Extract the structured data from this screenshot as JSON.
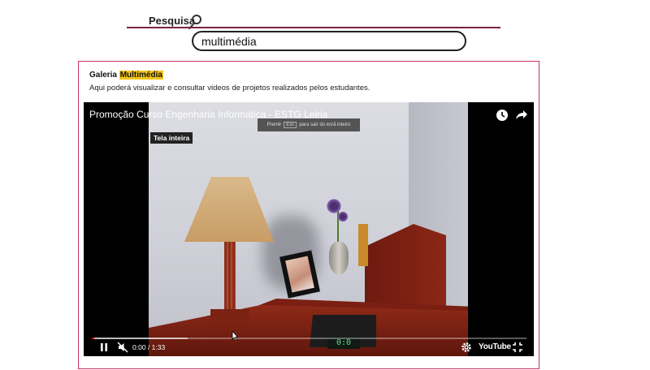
{
  "search": {
    "label": "Pesquisa",
    "value": "multimédia"
  },
  "gallery": {
    "title_prefix": "Galeria ",
    "title_highlight": "Multimédia",
    "description": "Aqui poderá visualizar e consultar videos de projetos realizados pelos estudantes."
  },
  "video": {
    "title": "Promoção Curso Engenharia Informática - ESTG Leiria",
    "esc_hint_prefix": "Premir",
    "esc_key": "Esc",
    "esc_hint_suffix": "para sair do ecrã inteiro",
    "fullscreen_tooltip": "Tela inteira",
    "time": "0:00 / 1:33",
    "vcr_display": "0:0",
    "progress_fraction": 0.006,
    "buffer_fraction": 0.22,
    "brand": "YouTube"
  },
  "colors": {
    "accent_line": "#7a2444",
    "panel_border": "#c8336a",
    "highlight": "#f5c518",
    "progress": "#ff0000"
  },
  "icons": [
    "search-icon",
    "clock-icon",
    "share-icon",
    "pause-icon",
    "mute-icon",
    "settings-icon",
    "exit-fullscreen-icon"
  ]
}
